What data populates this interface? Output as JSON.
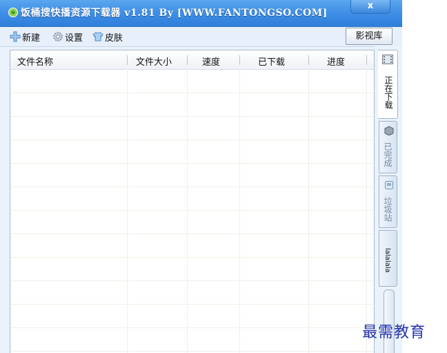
{
  "window": {
    "title": "饭桶搜快播资源下载器 v1.81 By [WWW.FANTONGSO.COM]",
    "close_label": "x"
  },
  "toolbar": {
    "new_label": "新建",
    "settings_label": "设置",
    "skin_label": "皮肤",
    "library_label": "影视库"
  },
  "list": {
    "columns": [
      "文件名称",
      "文件大小",
      "速度",
      "已下载",
      "进度"
    ],
    "rows": []
  },
  "side_tabs": [
    {
      "label": "正在下载",
      "active": true
    },
    {
      "label": "已完成",
      "active": false
    },
    {
      "label": "垃圾站",
      "active": false
    },
    {
      "label": "lalalala",
      "active": false
    }
  ],
  "watermark": "最需教育",
  "colors": {
    "titlebar": "#3e8ee6",
    "toolbar": "#e6effa",
    "watermark": "#2233aa"
  }
}
